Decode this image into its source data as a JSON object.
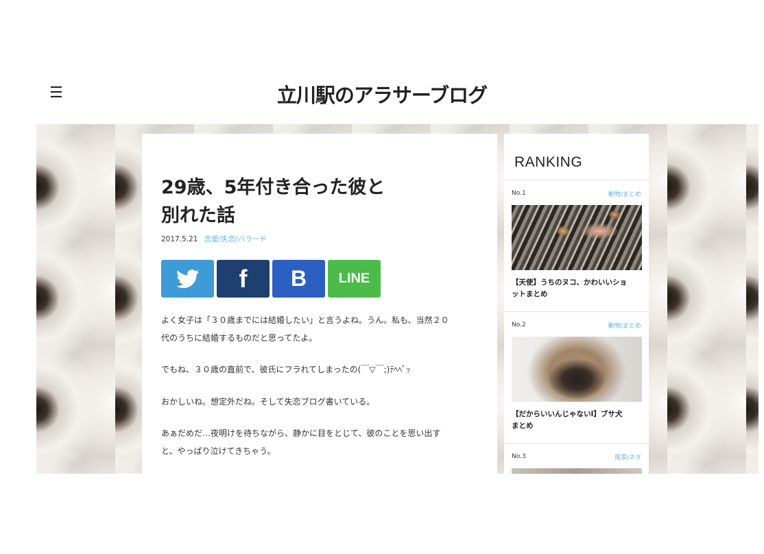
{
  "header": {
    "menu_icon": "menu-icon",
    "menu_glyph": "☰",
    "site_title": "立川駅のアラサーブログ"
  },
  "article": {
    "title_line1": "29歳、5年付き合った彼と",
    "title_line2": "別れた話",
    "date": "2017.5.21",
    "category": "恋愛/失恋/バラード",
    "share": {
      "twitter_icon": "twitter-bird-icon",
      "facebook_label": "f",
      "hatena_label": "B",
      "line_label": "LINE",
      "colors": {
        "twitter": "#3f9ad8",
        "facebook": "#1e3f70",
        "hatena": "#2b60c2",
        "line": "#4cbb4a"
      }
    },
    "paragraphs": [
      [
        "よく女子は「３０歳までには結婚したい」と言うよね。うん。私も、当然２０",
        "代のうちに結婚するものだと思ってたよ。"
      ],
      [
        "でもね、３０歳の直前で、彼氏にフラれてしまったの(￣▽￣;)ﾃﾍﾍﾟｯ"
      ],
      [
        "おかしいね。想定外だね。そして失恋ブログ書いている。"
      ],
      [
        "あぁだめだ…夜明けを待ちながら、静かに目をとじて、彼のことを思い出す",
        "と、やっぱり泣けてきちゃう。"
      ]
    ]
  },
  "sidebar": {
    "title": "RANKING",
    "items": [
      {
        "no": "No.1",
        "category": "動物/まとめ",
        "title_line1": "【天使】うちのヌコ、かわいいショ",
        "title_line2": "ットまとめ"
      },
      {
        "no": "No.2",
        "category": "動物/まとめ",
        "title_line1": "【だからいいんじゃないI】ブサ犬",
        "title_line2": "まとめ"
      },
      {
        "no": "No.3",
        "category": "風景/ネタ"
      }
    ]
  },
  "colors": {
    "accent_link": "#5fb6e6",
    "text": "#222222"
  }
}
